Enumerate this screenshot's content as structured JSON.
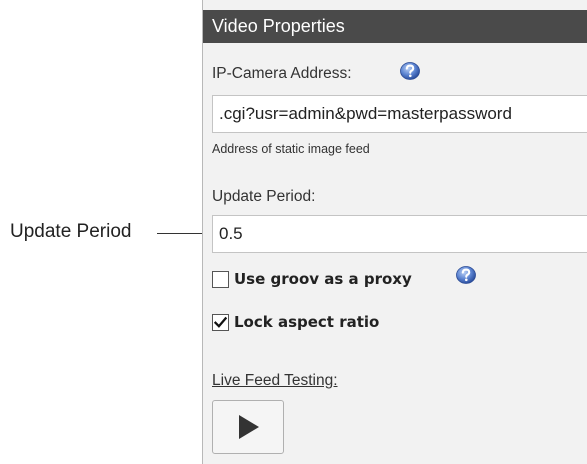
{
  "callout": {
    "label": "Update Period"
  },
  "panel": {
    "title": "Video Properties",
    "ip_camera": {
      "label": "IP-Camera Address:",
      "value": ".cgi?usr=admin&pwd=masterpassword",
      "hint": "Address of static image feed"
    },
    "update_period": {
      "label": "Update Period:",
      "value": "0.5"
    },
    "proxy": {
      "label": "Use groov as a proxy",
      "checked": false
    },
    "aspect": {
      "label": "Lock aspect ratio",
      "checked": true
    },
    "live_feed": {
      "label": "Live Feed Testing:"
    }
  },
  "icons": {
    "help": "help-icon",
    "play": "play-icon",
    "check": "checkmark-icon"
  },
  "colors": {
    "header_bg": "#4a4a4a",
    "panel_bg": "#f2f2f2",
    "help_icon": "#3a63b8"
  }
}
